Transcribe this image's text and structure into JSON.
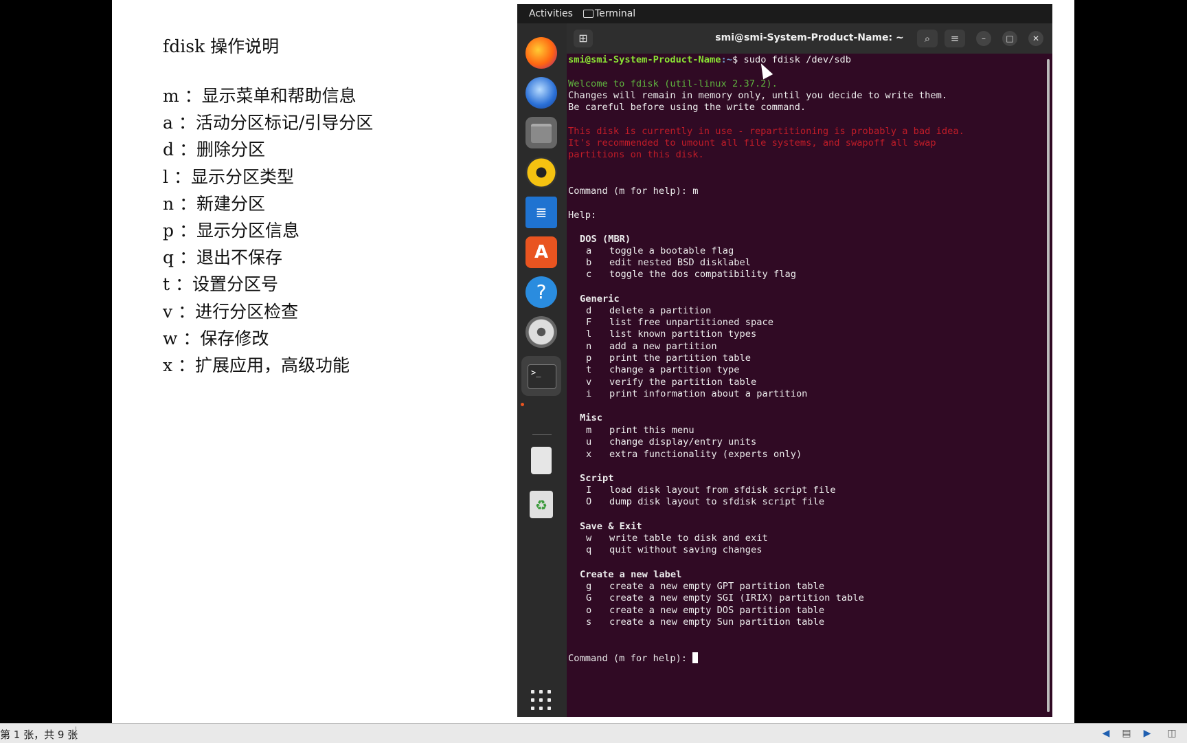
{
  "slide": {
    "title": "fdisk 操作说明",
    "notes": [
      "m ：显示菜单和帮助信息",
      "a ：活动分区标记/引导分区",
      "d ：删除分区",
      "l ：显示分区类型",
      "n ：新建分区",
      "p ：显示分区信息",
      "q ：退出不保存",
      "t ：设置分区号",
      "v ：进行分区检查",
      "w ：保存修改",
      "x ：扩展应用，高级功能"
    ]
  },
  "topbar": {
    "activities": "Activities",
    "app": "Terminal"
  },
  "dock": {
    "items": [
      "firefox-icon",
      "thunderbird-icon",
      "files-icon",
      "rhythmbox-icon",
      "libreoffice-writer-icon",
      "app-center-icon",
      "help-icon",
      "settings-icon",
      "terminal-icon",
      "usb-drive-icon",
      "trash-icon"
    ],
    "show_apps": "show-apps-grid-icon"
  },
  "terminal": {
    "title": "smi@smi-System-Product-Name: ~",
    "prompt_user": "smi@smi-System-Product-Name",
    "prompt_path": ":~",
    "prompt_symbol": "$ ",
    "command": "sudo fdisk /dev/sdb",
    "welcome": "Welcome to fdisk (util-linux 2.37.2).",
    "changes_line": "Changes will remain in memory only, until you decide to write them.",
    "careful_line": "Be careful before using the write command.",
    "warning_lines": [
      "This disk is currently in use - repartitioning is probably a bad idea.",
      "It's recommended to umount all file systems, and swapoff all swap",
      "partitions on this disk."
    ],
    "command_prompt_1": "Command (m for help): m",
    "help_label": "Help:",
    "sections": [
      {
        "heading": "DOS (MBR)",
        "items": [
          [
            "a",
            "toggle a bootable flag"
          ],
          [
            "b",
            "edit nested BSD disklabel"
          ],
          [
            "c",
            "toggle the dos compatibility flag"
          ]
        ]
      },
      {
        "heading": "Generic",
        "items": [
          [
            "d",
            "delete a partition"
          ],
          [
            "F",
            "list free unpartitioned space"
          ],
          [
            "l",
            "list known partition types"
          ],
          [
            "n",
            "add a new partition"
          ],
          [
            "p",
            "print the partition table"
          ],
          [
            "t",
            "change a partition type"
          ],
          [
            "v",
            "verify the partition table"
          ],
          [
            "i",
            "print information about a partition"
          ]
        ]
      },
      {
        "heading": "Misc",
        "items": [
          [
            "m",
            "print this menu"
          ],
          [
            "u",
            "change display/entry units"
          ],
          [
            "x",
            "extra functionality (experts only)"
          ]
        ]
      },
      {
        "heading": "Script",
        "items": [
          [
            "I",
            "load disk layout from sfdisk script file"
          ],
          [
            "O",
            "dump disk layout to sfdisk script file"
          ]
        ]
      },
      {
        "heading": "Save & Exit",
        "items": [
          [
            "w",
            "write table to disk and exit"
          ],
          [
            "q",
            "quit without saving changes"
          ]
        ]
      },
      {
        "heading": "Create a new label",
        "items": [
          [
            "g",
            "create a new empty GPT partition table"
          ],
          [
            "G",
            "create a new empty SGI (IRIX) partition table"
          ],
          [
            "o",
            "create a new empty DOS partition table"
          ],
          [
            "s",
            "create a new empty Sun partition table"
          ]
        ]
      }
    ],
    "command_prompt_2": "Command (m for help): "
  },
  "statusbar": {
    "slide_counter": "第 1 张，共 9 张"
  },
  "colors": {
    "terminal_bg": "#300a24",
    "prompt_user": "#8ae234",
    "prompt_path": "#729fcf",
    "warning": "#c01c28",
    "welcome": "#5fb33f"
  }
}
